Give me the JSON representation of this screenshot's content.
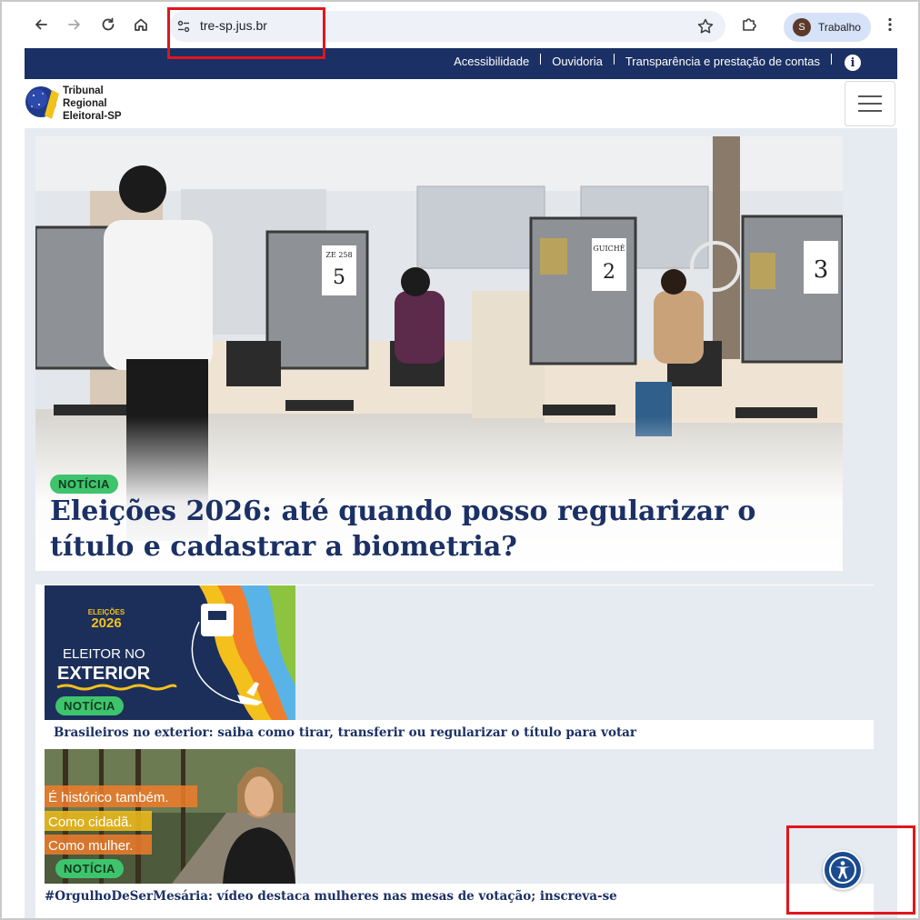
{
  "browser": {
    "url": "tre-sp.jus.br",
    "profile_initial": "S",
    "profile_name": "Trabalho"
  },
  "topnav": {
    "links": [
      "Acessibilidade",
      "Ouvidoria",
      "Transparência e prestação de contas"
    ],
    "info_label": "i"
  },
  "header": {
    "logo_line1": "Tribunal",
    "logo_line2": "Regional",
    "logo_line3": "Eleitoral-SP"
  },
  "hero": {
    "badge": "NOTÍCIA",
    "title": "Eleições 2026: até quando posso regularizar o título e cadastrar a biometria?",
    "booth_labels": [
      "ZE 258",
      "5",
      "GUICHÊ",
      "2",
      "3"
    ]
  },
  "news": [
    {
      "badge": "NOTÍCIA",
      "title": "Brasileiros no exterior: saiba como tirar, transferir ou regularizar o título para votar",
      "image_text": {
        "brand_top": "ELEIÇÕES",
        "brand_year": "2026",
        "line1": "ELEITOR NO",
        "line2": "EXTERIOR"
      }
    },
    {
      "badge": "NOTÍCIA",
      "title": "#OrgulhoDeSerMesária: vídeo destaca mulheres nas mesas de votação; inscreva-se",
      "image_text": {
        "line1": "É histórico também.",
        "line2": "Como cidadã.",
        "line3": "Como mulher."
      }
    }
  ],
  "colors": {
    "navy": "#1b3064",
    "badge_green": "#3ec46d",
    "highlight_red": "#e0161b",
    "page_bg": "#e6ebf1"
  },
  "icons": {
    "back": "back-arrow-icon",
    "forward": "forward-arrow-icon",
    "reload": "reload-icon",
    "home": "home-icon",
    "site_info": "tune-icon",
    "bookmark": "star-icon",
    "extensions": "puzzle-icon",
    "menu": "kebab-menu-icon",
    "hamburger": "hamburger-icon",
    "accessibility": "accessibility-icon"
  }
}
